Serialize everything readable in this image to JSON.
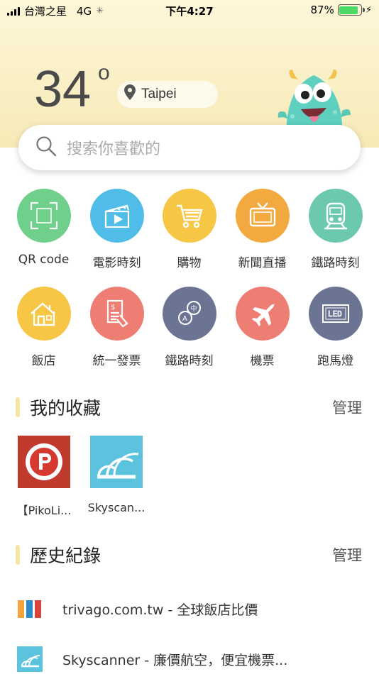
{
  "status_bar": {
    "carrier": "台灣之星",
    "network": "4G",
    "time": "下午4:27",
    "battery_pct": "87%",
    "battery_level": 0.87
  },
  "weather": {
    "temperature": "34",
    "degree_symbol": "o",
    "location": "Taipei"
  },
  "search": {
    "placeholder": "搜索你喜歡的"
  },
  "grid": [
    {
      "label": "QR code",
      "icon": "qr-scan-icon",
      "color": "#6fd08c"
    },
    {
      "label": "電影時刻",
      "icon": "clapperboard-icon",
      "color": "#4fbde8"
    },
    {
      "label": "購物",
      "icon": "shopping-cart-icon",
      "color": "#f6c644"
    },
    {
      "label": "新聞直播",
      "icon": "tv-icon",
      "color": "#f2a93f"
    },
    {
      "label": "鐵路時刻",
      "icon": "train-icon",
      "color": "#6cc9ad"
    },
    {
      "label": "飯店",
      "icon": "house-icon",
      "color": "#f6c644"
    },
    {
      "label": "統一發票",
      "icon": "receipt-icon",
      "color": "#ee7e74"
    },
    {
      "label": "鐵路時刻",
      "icon": "translate-icon",
      "color": "#6c7494"
    },
    {
      "label": "機票",
      "icon": "airplane-icon",
      "color": "#ee7e74"
    },
    {
      "label": "跑馬燈",
      "icon": "led-sign-icon",
      "color": "#6c7494"
    }
  ],
  "favorites": {
    "title": "我的收藏",
    "manage": "管理",
    "items": [
      {
        "label": "【PikoLi...",
        "icon": "pikolive-logo-icon"
      },
      {
        "label": "Skyscan...",
        "icon": "skyscanner-logo-icon"
      }
    ]
  },
  "history": {
    "title": "歷史紀錄",
    "manage": "管理",
    "items": [
      {
        "label": "trivago.com.tw - 全球飯店比價",
        "icon": "trivago-logo-icon"
      },
      {
        "label": "Skyscanner - 廉價航空，便宜機票...",
        "icon": "skyscanner-logo-icon"
      }
    ]
  }
}
